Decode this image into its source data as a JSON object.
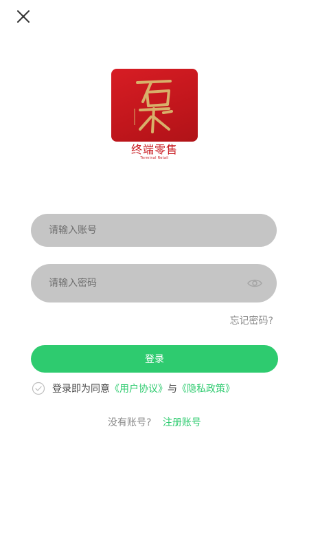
{
  "header": {
    "close_icon": "close-icon"
  },
  "logo": {
    "brand_text": "终端零售",
    "sub_text": "Terminal Retail",
    "colors": {
      "tile": "#d71d24",
      "glyph": "#d8b06a",
      "text": "#c8191f"
    }
  },
  "form": {
    "account": {
      "placeholder": "请输入账号",
      "value": ""
    },
    "password": {
      "placeholder": "请输入密码",
      "value": "",
      "toggle_icon": "eye-icon"
    },
    "forgot_label": "忘记密码?",
    "login_label": "登录"
  },
  "agreement": {
    "check_icon": "check-circle-icon",
    "prefix": "登录即为同意",
    "user_agreement": "《用户协议》",
    "and": "与",
    "privacy_policy": "《隐私政策》"
  },
  "register": {
    "question": "没有账号?",
    "link_label": "注册账号"
  },
  "colors": {
    "accent": "#2ecb6f",
    "input_bg": "#c5c5c5",
    "muted_text": "#8a8a8a"
  }
}
